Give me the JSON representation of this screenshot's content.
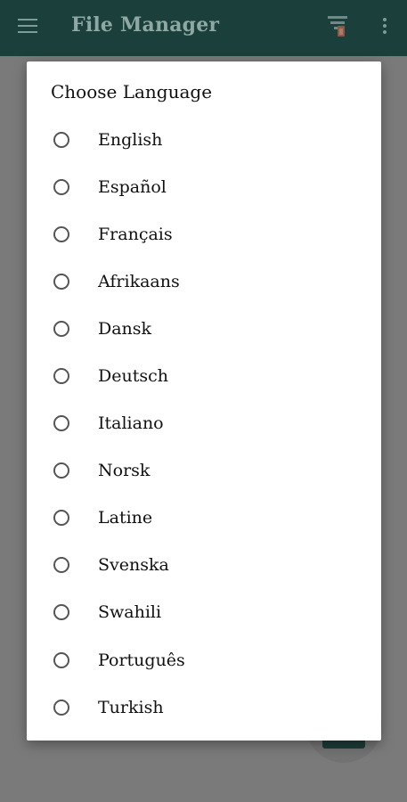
{
  "app_bar": {
    "title": "File Manager",
    "menu_icon": "hamburger-menu-icon",
    "sort_icon": "sort-filter-icon",
    "overflow_icon": "more-vert-icon",
    "background_color": "#1b3f3b"
  },
  "dialog": {
    "title": "Choose Language",
    "options": [
      {
        "label": "English",
        "selected": false
      },
      {
        "label": "Español",
        "selected": false
      },
      {
        "label": "Français",
        "selected": false
      },
      {
        "label": "Afrikaans",
        "selected": false
      },
      {
        "label": "Dansk",
        "selected": false
      },
      {
        "label": "Deutsch",
        "selected": false
      },
      {
        "label": "Italiano",
        "selected": false
      },
      {
        "label": "Norsk",
        "selected": false
      },
      {
        "label": "Latine",
        "selected": false
      },
      {
        "label": "Svenska",
        "selected": false
      },
      {
        "label": "Swahili",
        "selected": false
      },
      {
        "label": "Português",
        "selected": false
      },
      {
        "label": "Turkish",
        "selected": false
      }
    ]
  }
}
